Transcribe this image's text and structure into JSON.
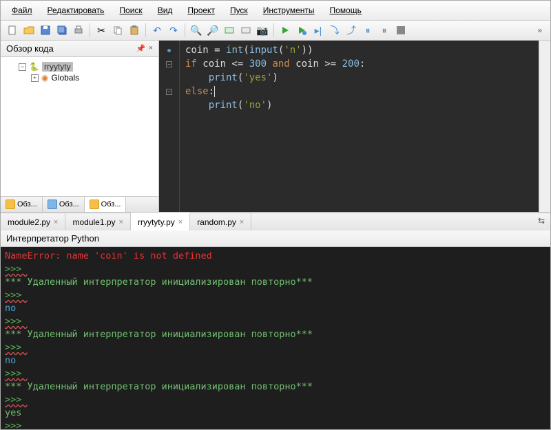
{
  "menu": {
    "items": [
      "Файл",
      "Редактировать",
      "Поиск",
      "Вид",
      "Проект",
      "Пуск",
      "Инструменты",
      "Помощь"
    ]
  },
  "toolbar": {
    "new": "new",
    "open": "open",
    "save": "save",
    "saveall": "saveall",
    "print": "print",
    "cut": "cut",
    "copy": "copy",
    "paste": "paste",
    "undo": "undo",
    "redo": "redo",
    "find": "find",
    "findnext": "findnext",
    "comment": "comment",
    "uncomment": "uncomment",
    "camera": "camera",
    "run": "run",
    "debug": "debug",
    "stepover": "stepover",
    "stepinto": "stepinto",
    "stepout": "stepout",
    "breakpoint": "breakpoint",
    "stop": "stop",
    "stopall": "stopall",
    "overflow": "»"
  },
  "sidebar": {
    "title": "Обзор кода",
    "pin_icon": "pin",
    "close_icon": "×",
    "root": "rryytyty",
    "child": "Globals",
    "tabs": [
      "Обз...",
      "Обз...",
      "Обз..."
    ]
  },
  "editor": {
    "lines": [
      {
        "raw": "coin = int(input('n'))",
        "tokens": [
          [
            "",
            "coin = "
          ],
          [
            "fn",
            "int"
          ],
          [
            "",
            "("
          ],
          [
            "fn",
            "input"
          ],
          [
            "",
            "("
          ],
          [
            "str",
            "'n'"
          ],
          [
            "",
            "))"
          ]
        ]
      },
      {
        "raw": "if coin <= 300 and coin >= 200:",
        "tokens": [
          [
            "kw",
            "if"
          ],
          [
            "",
            " coin <= "
          ],
          [
            "num",
            "300"
          ],
          [
            "",
            " "
          ],
          [
            "kw",
            "and"
          ],
          [
            "",
            " coin >= "
          ],
          [
            "num",
            "200"
          ],
          [
            "",
            ":"
          ]
        ]
      },
      {
        "raw": "    print('yes')",
        "tokens": [
          [
            "",
            "    "
          ],
          [
            "fn",
            "print"
          ],
          [
            "",
            "("
          ],
          [
            "str",
            "'yes'"
          ],
          [
            "",
            ")"
          ]
        ]
      },
      {
        "raw": "else:",
        "tokens": [
          [
            "kw",
            "else"
          ],
          [
            "",
            ":"
          ]
        ],
        "cursor": true
      },
      {
        "raw": "    print('no')",
        "tokens": [
          [
            "",
            "    "
          ],
          [
            "fn",
            "print"
          ],
          [
            "",
            "("
          ],
          [
            "str",
            "'no'"
          ],
          [
            "",
            ")"
          ]
        ]
      }
    ]
  },
  "filetabs": {
    "items": [
      {
        "label": "module2.py",
        "active": false
      },
      {
        "label": "module1.py",
        "active": false
      },
      {
        "label": "rryytyty.py",
        "active": true
      },
      {
        "label": "random.py",
        "active": false
      }
    ],
    "overflow": "⇆"
  },
  "interpreter": {
    "title": "Интерпретатор Python",
    "lines": [
      {
        "cls": "err",
        "text": "NameError: name 'coin' is not defined"
      },
      {
        "cls": "pr",
        "text": ">>> "
      },
      {
        "cls": "msg",
        "text": "*** Удаленный интерпретатор инициализирован повторно***"
      },
      {
        "cls": "pr",
        "text": ">>> "
      },
      {
        "cls": "out-no",
        "text": "no"
      },
      {
        "cls": "pr",
        "text": ">>> "
      },
      {
        "cls": "msg",
        "text": "*** Удаленный интерпретатор инициализирован повторно***"
      },
      {
        "cls": "pr",
        "text": ">>> "
      },
      {
        "cls": "out-no",
        "text": "no"
      },
      {
        "cls": "pr",
        "text": ">>> "
      },
      {
        "cls": "msg",
        "text": "*** Удаленный интерпретатор инициализирован повторно***"
      },
      {
        "cls": "pr",
        "text": ">>> "
      },
      {
        "cls": "out-yes",
        "text": "yes"
      },
      {
        "cls": "pr",
        "text": ">>> "
      }
    ]
  }
}
